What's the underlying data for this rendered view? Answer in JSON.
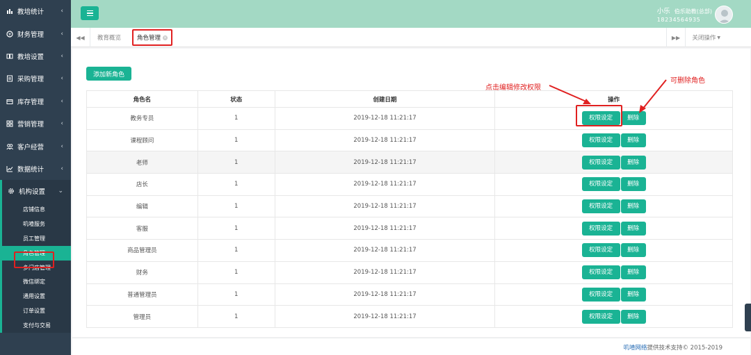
{
  "sidebar": {
    "items": [
      {
        "label": "教培统计",
        "icon": "chart-icon"
      },
      {
        "label": "财务管理",
        "icon": "money-icon"
      },
      {
        "label": "教培设置",
        "icon": "book-icon"
      },
      {
        "label": "采购管理",
        "icon": "cart-icon"
      },
      {
        "label": "库存管理",
        "icon": "box-icon"
      },
      {
        "label": "营销管理",
        "icon": "grid-icon"
      },
      {
        "label": "客户经营",
        "icon": "users-icon"
      },
      {
        "label": "数据统计",
        "icon": "trend-icon"
      },
      {
        "label": "机构设置",
        "icon": "gear-icon"
      }
    ],
    "subitems": [
      "店铺信息",
      "叽喳服务",
      "员工管理",
      "角色管理",
      "多门店管理",
      "微信绑定",
      "通用设置",
      "订单设置",
      "支付与交易"
    ]
  },
  "header": {
    "user_name": "小乐",
    "org_name": "伯乐助教(总部)",
    "phone": "18234564935"
  },
  "tabs": {
    "tab1": "教育概览",
    "tab2": "角色管理",
    "close_ops": "关闭操作"
  },
  "main": {
    "add_button": "添加新角色",
    "columns": [
      "角色名",
      "状态",
      "创建日期",
      "操作"
    ],
    "rows": [
      {
        "name": "教务专员",
        "status": "1",
        "date": "2019-12-18 11:21:17"
      },
      {
        "name": "课程顾问",
        "status": "1",
        "date": "2019-12-18 11:21:17"
      },
      {
        "name": "老师",
        "status": "1",
        "date": "2019-12-18 11:21:17"
      },
      {
        "name": "店长",
        "status": "1",
        "date": "2019-12-18 11:21:17"
      },
      {
        "name": "编辑",
        "status": "1",
        "date": "2019-12-18 11:21:17"
      },
      {
        "name": "客服",
        "status": "1",
        "date": "2019-12-18 11:21:17"
      },
      {
        "name": "商品管理员",
        "status": "1",
        "date": "2019-12-18 11:21:17"
      },
      {
        "name": "财务",
        "status": "1",
        "date": "2019-12-18 11:21:17"
      },
      {
        "name": "普通管理员",
        "status": "1",
        "date": "2019-12-18 11:21:17"
      },
      {
        "name": "管理员",
        "status": "1",
        "date": "2019-12-18 11:21:17"
      }
    ],
    "perm_label": "权限设定",
    "delete_label": "删除"
  },
  "annotations": {
    "edit_perm": "点击编辑修改权限",
    "delete_role": "可删除角色"
  },
  "footer": {
    "link": "叽喳网络",
    "text": "提供技术支持© 2015-2019"
  },
  "colors": {
    "accent": "#1ab394",
    "sidebar": "#2f4050",
    "header": "#a3d9c4",
    "annotation": "#e02020"
  }
}
